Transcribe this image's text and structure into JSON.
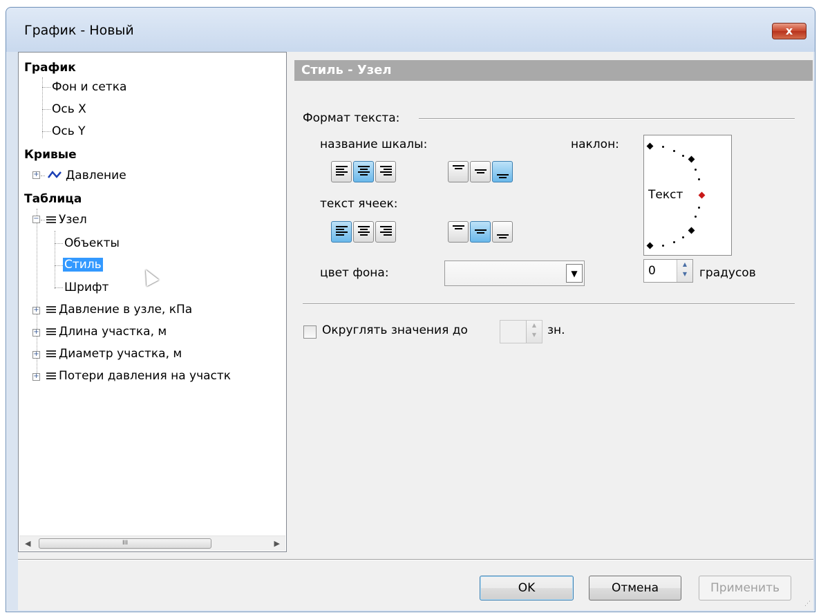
{
  "window": {
    "title": "График - Новый",
    "close_glyph": "x"
  },
  "tree": {
    "grafik": "График",
    "fon": "Фон и сетка",
    "os_x": "Ось X",
    "os_y": "Ось Y",
    "krivye": "Кривые",
    "davlenie": "Давление",
    "tablica": "Таблица",
    "uzel": "Узел",
    "obekty": "Объекты",
    "stil": "Стиль",
    "shrift": "Шрифт",
    "col1": "Давление в узле, кПа",
    "col2": "Длина участка, м",
    "col3": "Диаметр участка, м",
    "col4": "Потери давления на участк",
    "curve_color": "#1a3fb5",
    "selected_color": "#3399ff"
  },
  "panel": {
    "header": "Стиль - Узел",
    "format_label": "Формат текста:",
    "scale_label": "название шкалы:",
    "cells_label": "текст ячеек:",
    "bg_label": "цвет фона:",
    "tilt_label": "наклон:",
    "sample_text": "Текст",
    "angle_value": "0",
    "degrees_label": "градусов",
    "round_label": "Округлять значения до",
    "round_unit": "зн."
  },
  "buttons": {
    "ok": "OK",
    "cancel": "Отмена",
    "apply": "Применить"
  }
}
